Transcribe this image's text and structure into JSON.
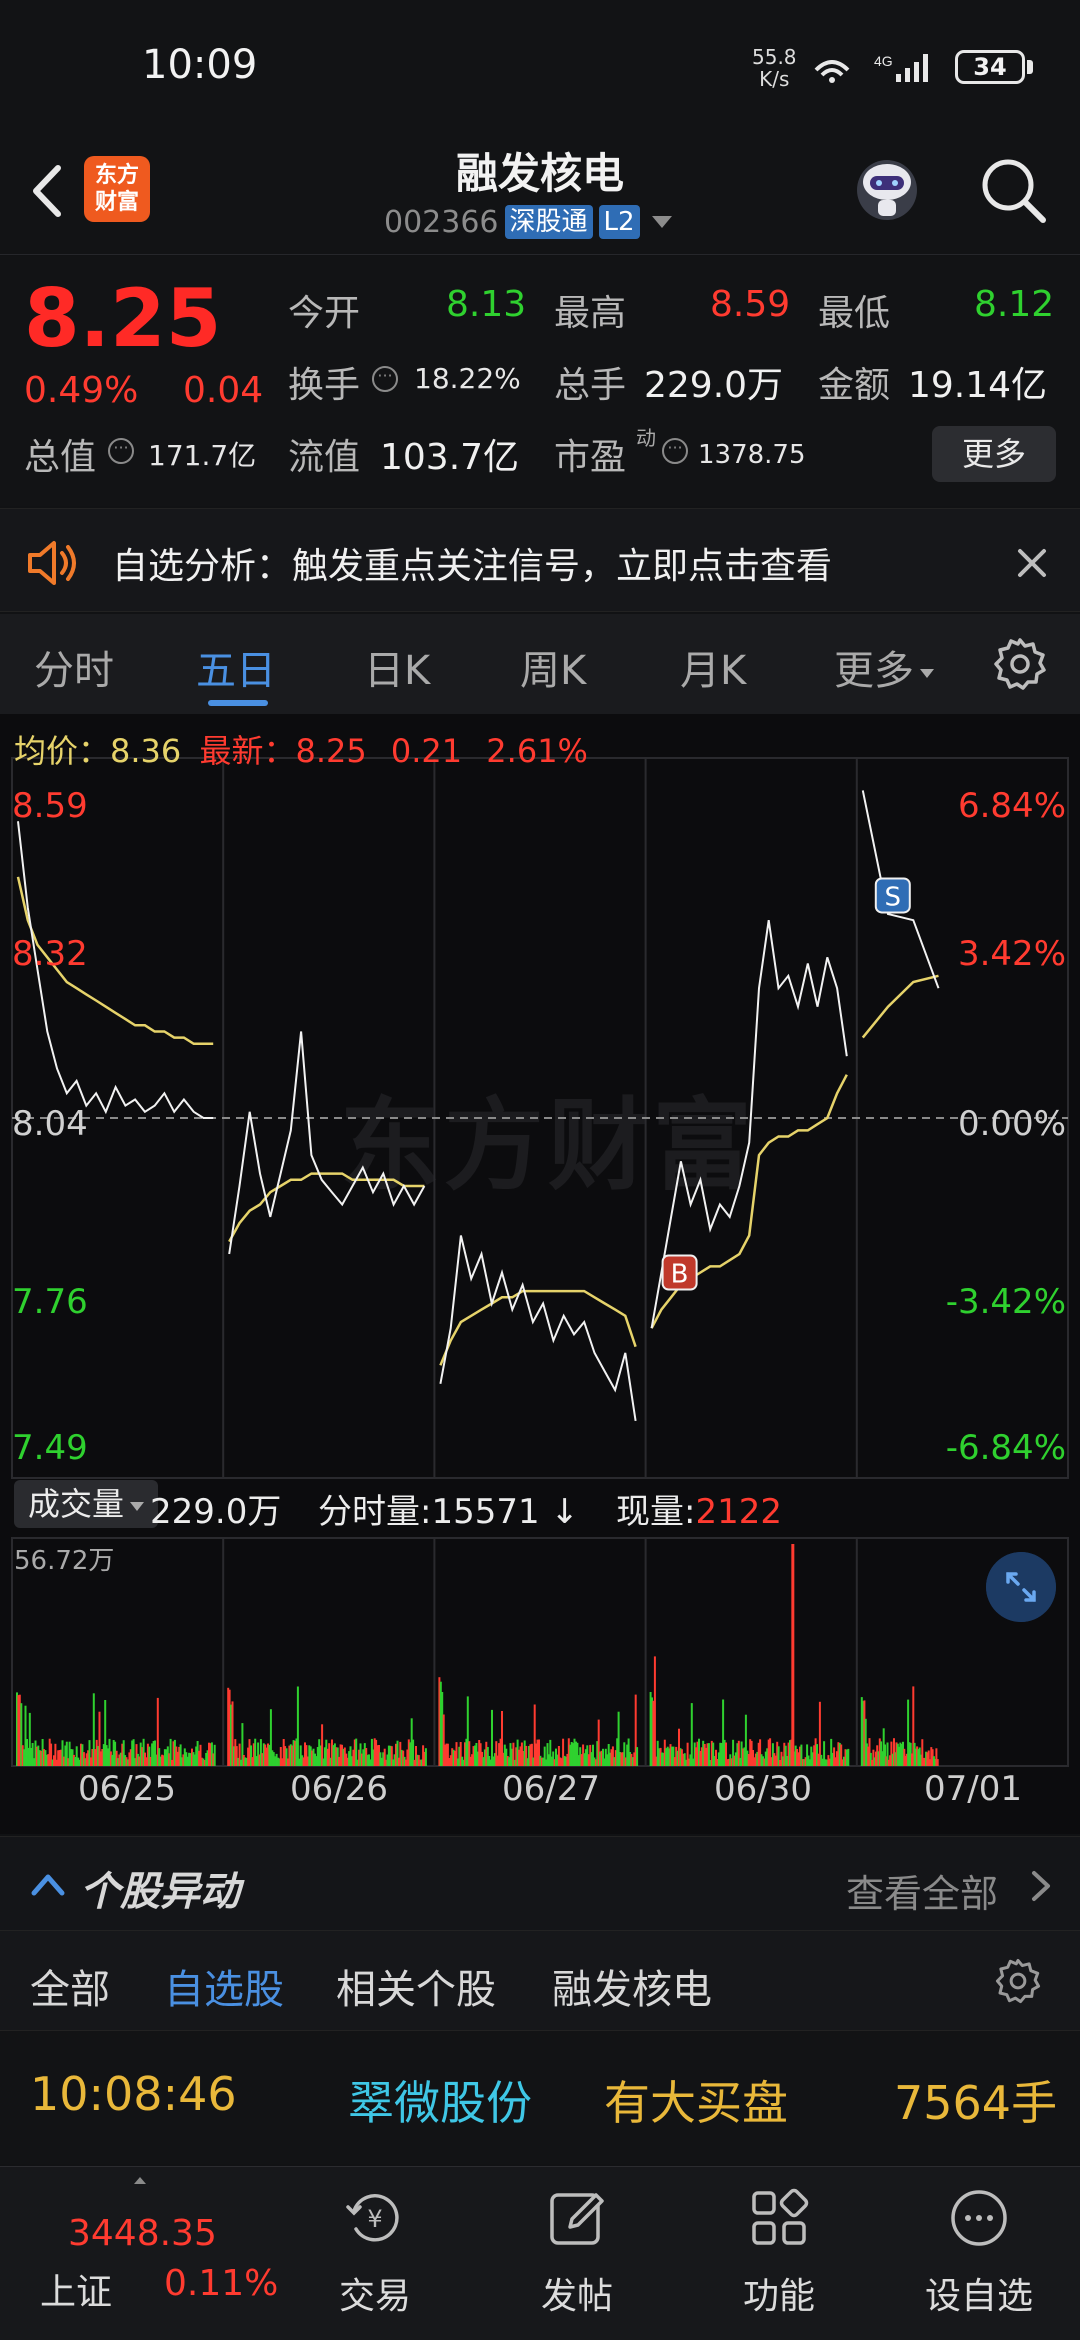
{
  "status": {
    "time": "10:09",
    "net_speed": "55.8",
    "net_unit": "K/s",
    "network": "4G",
    "battery": "34"
  },
  "header": {
    "logo_line1": "东方",
    "logo_line2": "财富",
    "title": "融发核电",
    "code": "002366",
    "tag1": "深股通",
    "tag2": "L2"
  },
  "quote": {
    "price": "8.25",
    "change_pct": "0.49%",
    "change": "0.04",
    "open_label": "今开",
    "open": "8.13",
    "high_label": "最高",
    "high": "8.59",
    "low_label": "最低",
    "low": "8.12",
    "turnover_label": "换手",
    "turnover": "18.22%",
    "volume_label": "总手",
    "volume": "229.0万",
    "amount_label": "金额",
    "amount": "19.14亿",
    "mcap_label": "总值",
    "mcap": "171.7亿",
    "float_label": "流值",
    "float": "103.7亿",
    "pe_label": "市盈",
    "pe_sup": "动",
    "pe": "1378.75",
    "more": "更多"
  },
  "banner": {
    "text": "自选分析：触发重点关注信号，立即点击查看"
  },
  "tabs": [
    "分时",
    "五日",
    "日K",
    "周K",
    "月K",
    "更多"
  ],
  "chart_legend": {
    "avg_label": "均价：",
    "avg": "8.36",
    "latest_label": "最新：",
    "latest": "8.25",
    "diff": "0.21",
    "diff_pct": "2.61%"
  },
  "colors": {
    "up": "#ff3b30",
    "down": "#2fd12f",
    "accent": "#4a90e2",
    "avg_line": "#e6d36a",
    "price_line": "#f2f2f2"
  },
  "chart_data": {
    "type": "line",
    "title": "",
    "x": [
      "06/25",
      "06/26",
      "06/27",
      "06/30",
      "07/01"
    ],
    "y_ticks": [
      "8.59",
      "8.32",
      "8.04",
      "7.76",
      "7.49"
    ],
    "y_pct_ticks": [
      "6.84%",
      "3.42%",
      "0.00%",
      "-3.42%",
      "-6.84%"
    ],
    "ylim": [
      7.49,
      8.59
    ],
    "reference": 8.04,
    "markers": [
      {
        "label": "B",
        "day": "06/30",
        "price": 7.79
      },
      {
        "label": "S",
        "day": "07/01",
        "price": 8.4
      }
    ],
    "series": [
      {
        "values": [
          8.52,
          8.38,
          8.28,
          8.18,
          8.12,
          8.08,
          8.1,
          8.06,
          8.08,
          8.05,
          8.09,
          8.06,
          8.07,
          8.05,
          8.06,
          8.08,
          8.05,
          8.07,
          8.05,
          8.04,
          8.04,
          7.82,
          7.93,
          8.05,
          7.95,
          7.88,
          7.95,
          8.02,
          8.18,
          7.98,
          7.94,
          7.92,
          7.9,
          7.93,
          7.96,
          7.92,
          7.95,
          7.9,
          7.93,
          7.9,
          7.93,
          7.61,
          7.7,
          7.85,
          7.78,
          7.82,
          7.74,
          7.79,
          7.73,
          7.77,
          7.71,
          7.74,
          7.68,
          7.72,
          7.69,
          7.71,
          7.66,
          7.63,
          7.6,
          7.66,
          7.55,
          7.7,
          7.79,
          7.88,
          7.97,
          7.9,
          7.94,
          7.86,
          7.9,
          7.88,
          7.93,
          8.0,
          8.25,
          8.36,
          8.25,
          8.27,
          8.22,
          8.29,
          8.22,
          8.3,
          8.25,
          8.14,
          8.57,
          8.37,
          8.36,
          8.25
        ]
      },
      {
        "values": [
          8.43,
          8.36,
          8.32,
          8.3,
          8.28,
          8.26,
          8.25,
          8.24,
          8.23,
          8.22,
          8.21,
          8.2,
          8.19,
          8.19,
          8.18,
          8.18,
          8.17,
          8.17,
          8.16,
          8.16,
          8.16,
          7.84,
          7.87,
          7.89,
          7.9,
          7.92,
          7.93,
          7.94,
          7.94,
          7.95,
          7.95,
          7.95,
          7.95,
          7.94,
          7.94,
          7.94,
          7.94,
          7.94,
          7.93,
          7.93,
          7.93,
          7.64,
          7.68,
          7.71,
          7.72,
          7.73,
          7.74,
          7.75,
          7.75,
          7.76,
          7.76,
          7.76,
          7.76,
          7.76,
          7.76,
          7.76,
          7.75,
          7.74,
          7.73,
          7.72,
          7.67,
          7.7,
          7.73,
          7.75,
          7.77,
          7.78,
          7.79,
          7.8,
          7.8,
          7.81,
          7.82,
          7.85,
          7.98,
          8.0,
          8.01,
          8.01,
          8.02,
          8.02,
          8.03,
          8.04,
          8.08,
          8.11,
          8.17,
          8.22,
          8.26,
          8.27
        ]
      }
    ]
  },
  "volume": {
    "label": "成交量",
    "total": "229.0万",
    "tick_label": "分时量:",
    "tick": "15571",
    "now_label": "现量:",
    "now": "2122",
    "max": "56.72万"
  },
  "movers": {
    "title": "个股异动",
    "view_all": "查看全部",
    "filters": [
      "全部",
      "自选股",
      "相关个股",
      "融发核电"
    ],
    "row": {
      "time": "10:08:46",
      "stock": "翠微股份",
      "event": "有大买盘",
      "qty": "7564手"
    }
  },
  "nav": {
    "index_value": "3448.35",
    "index_name": "上证",
    "index_pct": "0.11%",
    "items": [
      "交易",
      "发帖",
      "功能",
      "设自选"
    ]
  }
}
